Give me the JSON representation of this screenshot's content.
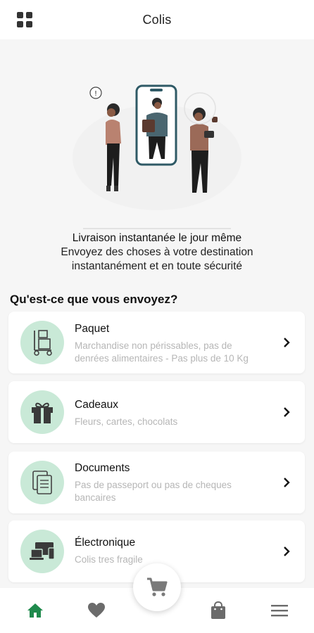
{
  "header": {
    "title": "Colis",
    "menu_icon": "apps-grid-icon"
  },
  "hero": {
    "headline": "Livraison instantanée le jour même",
    "subline_1": "Envoyez des choses à votre destination",
    "subline_2": "instantanément et en toute sécurité"
  },
  "section": {
    "title": "Qu'est-ce que vous envoyez?"
  },
  "categories": [
    {
      "name": "Paquet",
      "desc_1": "Marchandise non périssables, pas de",
      "desc_2": "denrées alimentaires - Pas plus de 10 Kg",
      "icon": "trolley-box-icon"
    },
    {
      "name": "Cadeaux",
      "desc_1": "Fleurs, cartes, chocolats",
      "desc_2": "",
      "icon": "gift-icon"
    },
    {
      "name": "Documents",
      "desc_1": "Pas de passeport ou pas de cheques",
      "desc_2": "bancaires",
      "icon": "documents-icon"
    },
    {
      "name": "Électronique",
      "desc_1": "Colis tres fragile",
      "desc_2": "",
      "icon": "electronics-icon"
    }
  ],
  "bottom_nav": {
    "items": [
      "home-icon",
      "heart-icon",
      "cart-icon",
      "shopping-bag-icon",
      "menu-icon"
    ],
    "active": "home-icon",
    "active_color": "#1f8a4c"
  },
  "colors": {
    "accent_light": "#c9e9d7",
    "accent": "#1f8a4c"
  }
}
